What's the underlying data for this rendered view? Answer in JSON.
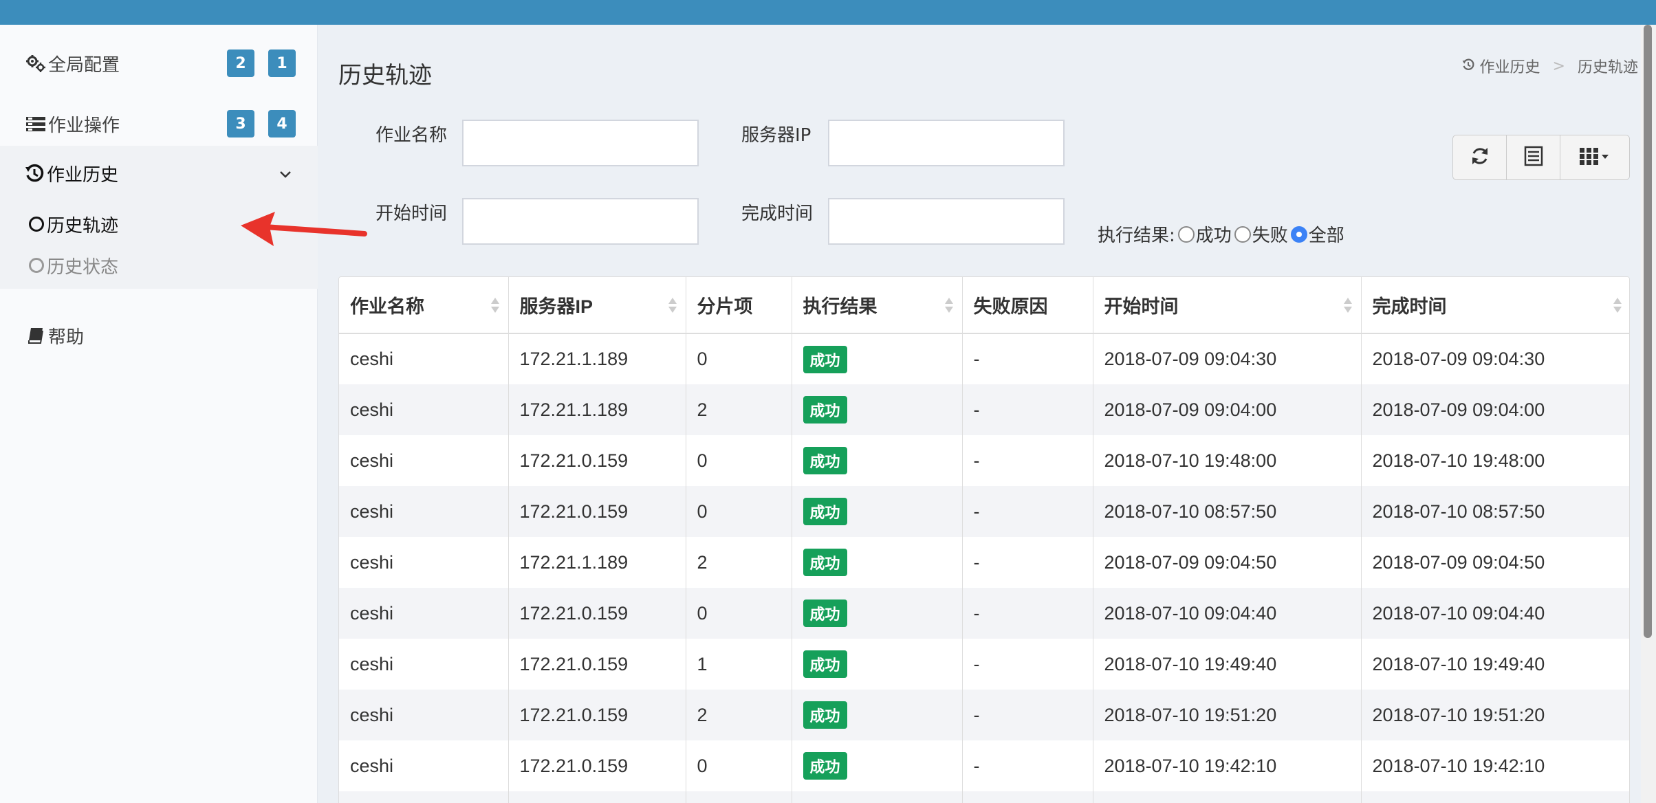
{
  "sidebar": {
    "items": [
      {
        "icon": "gears-icon",
        "label": "全局配置",
        "badges": [
          "2",
          "1"
        ]
      },
      {
        "icon": "list-icon",
        "label": "作业操作",
        "badges": [
          "3",
          "4"
        ]
      },
      {
        "icon": "history-icon",
        "label": "作业历史",
        "expanded": true,
        "children": [
          {
            "label": "历史轨迹",
            "active": true
          },
          {
            "label": "历史状态",
            "active": false
          }
        ]
      },
      {
        "icon": "book-icon",
        "label": "帮助"
      }
    ]
  },
  "page": {
    "title": "历史轨迹",
    "breadcrumb": [
      "作业历史",
      "历史轨迹"
    ]
  },
  "filters": {
    "job_name_label": "作业名称",
    "job_name_value": "",
    "server_ip_label": "服务器IP",
    "server_ip_value": "",
    "start_time_label": "开始时间",
    "start_time_value": "",
    "end_time_label": "完成时间",
    "end_time_value": "",
    "result_label": "执行结果:",
    "result_options": [
      "成功",
      "失败",
      "全部"
    ],
    "result_selected": "全部"
  },
  "toolbar": {
    "buttons": [
      "refresh-icon",
      "toggle-view-icon",
      "columns-icon"
    ]
  },
  "table": {
    "columns": [
      "作业名称",
      "服务器IP",
      "分片项",
      "执行结果",
      "失败原因",
      "开始时间",
      "完成时间"
    ],
    "rows": [
      [
        "ceshi",
        "172.21.1.189",
        "0",
        "成功",
        "-",
        "2018-07-09 09:04:30",
        "2018-07-09 09:04:30"
      ],
      [
        "ceshi",
        "172.21.1.189",
        "2",
        "成功",
        "-",
        "2018-07-09 09:04:00",
        "2018-07-09 09:04:00"
      ],
      [
        "ceshi",
        "172.21.0.159",
        "0",
        "成功",
        "-",
        "2018-07-10 19:48:00",
        "2018-07-10 19:48:00"
      ],
      [
        "ceshi",
        "172.21.0.159",
        "0",
        "成功",
        "-",
        "2018-07-10 08:57:50",
        "2018-07-10 08:57:50"
      ],
      [
        "ceshi",
        "172.21.1.189",
        "2",
        "成功",
        "-",
        "2018-07-09 09:04:50",
        "2018-07-09 09:04:50"
      ],
      [
        "ceshi",
        "172.21.0.159",
        "0",
        "成功",
        "-",
        "2018-07-10 09:04:40",
        "2018-07-10 09:04:40"
      ],
      [
        "ceshi",
        "172.21.0.159",
        "1",
        "成功",
        "-",
        "2018-07-10 19:49:40",
        "2018-07-10 19:49:40"
      ],
      [
        "ceshi",
        "172.21.0.159",
        "2",
        "成功",
        "-",
        "2018-07-10 19:51:20",
        "2018-07-10 19:51:20"
      ],
      [
        "ceshi",
        "172.21.0.159",
        "0",
        "成功",
        "-",
        "2018-07-10 19:42:10",
        "2018-07-10 19:42:10"
      ],
      [
        "",
        "",
        "",
        "",
        "",
        "",
        ""
      ]
    ]
  },
  "colors": {
    "topbar": "#3c8dbc",
    "badge": "#3c8dbc",
    "success": "#16a05a",
    "arrow": "#e8332b"
  }
}
